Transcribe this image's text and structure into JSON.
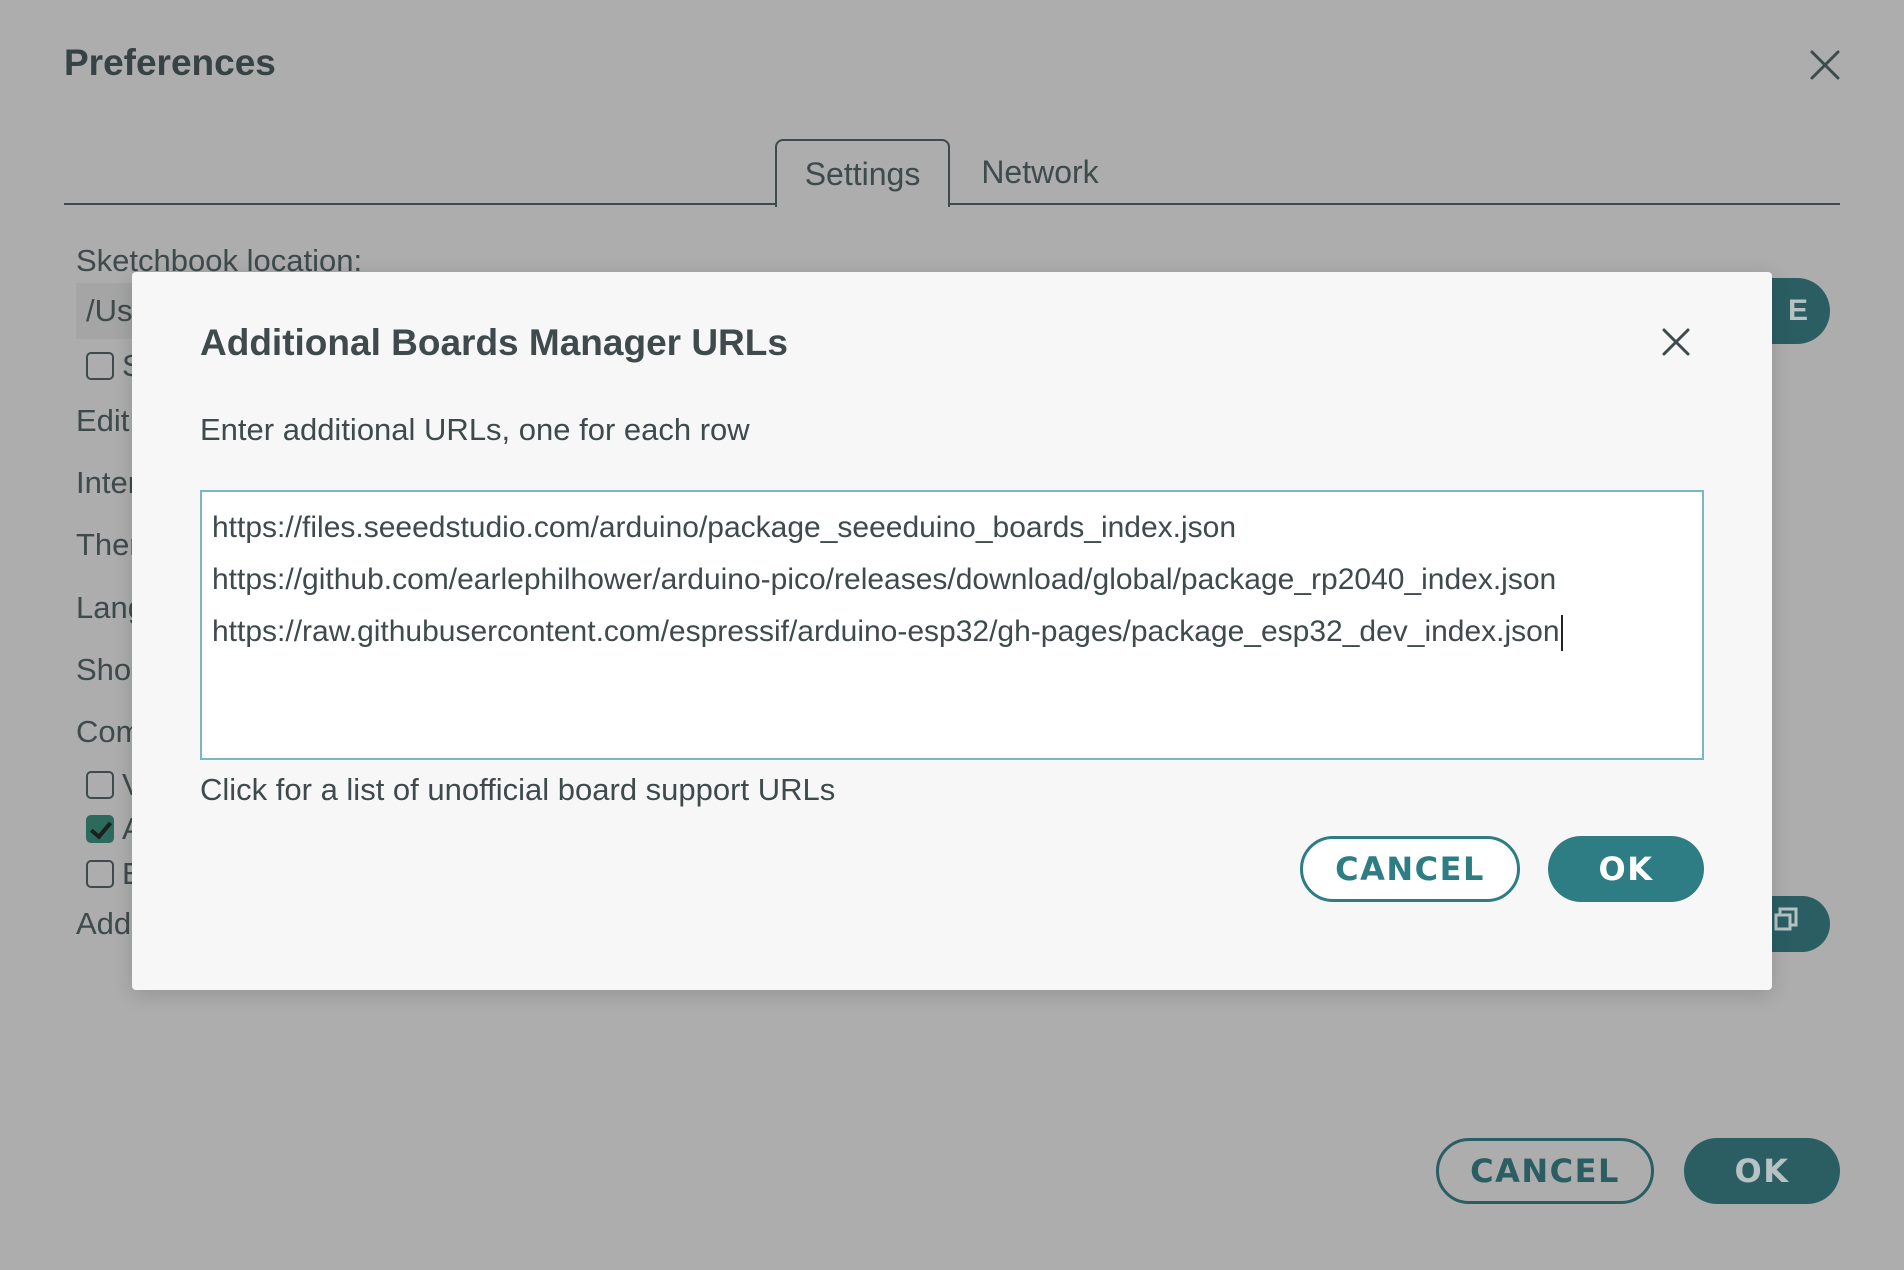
{
  "preferences": {
    "title": "Preferences",
    "tabs": [
      {
        "label": "Settings",
        "active": true
      },
      {
        "label": "Network",
        "active": false
      }
    ],
    "sketchbook_label": "Sketchbook location:",
    "sketchbook_path_visible": "/Us",
    "checkbox_1_letter": "S",
    "row_labels_visible": [
      "Edit",
      "Inter",
      "Ther",
      "Lang",
      "Sho",
      "Com"
    ],
    "checkbox_rows": [
      {
        "letter": "V",
        "checked": false
      },
      {
        "letter": "A",
        "checked": true
      },
      {
        "letter": "E",
        "checked": false
      }
    ],
    "add_label_visible": "Add",
    "browse_peek": "E",
    "urls_button_icon": "window-restore-icon",
    "cancel_label": "CANCEL",
    "ok_label": "OK"
  },
  "modal": {
    "title": "Additional Boards Manager URLs",
    "subtitle": "Enter additional URLs, one for each row",
    "urls": [
      "https://files.seeedstudio.com/arduino/package_seeeduino_boards_index.json",
      "https://github.com/earlephilhower/arduino-pico/releases/download/global/package_rp2040_index.json",
      "https://raw.githubusercontent.com/espressif/arduino-esp32/gh-pages/package_esp32_dev_index.json"
    ],
    "link_text": "Click for a list of unofficial board support URLs",
    "cancel_label": "CANCEL",
    "ok_label": "OK"
  },
  "colors": {
    "accent": "#2e7d84",
    "accent_dimmed": "#2a5e63",
    "overlay_bg": "#acadac",
    "modal_bg": "#f6f7f6"
  }
}
